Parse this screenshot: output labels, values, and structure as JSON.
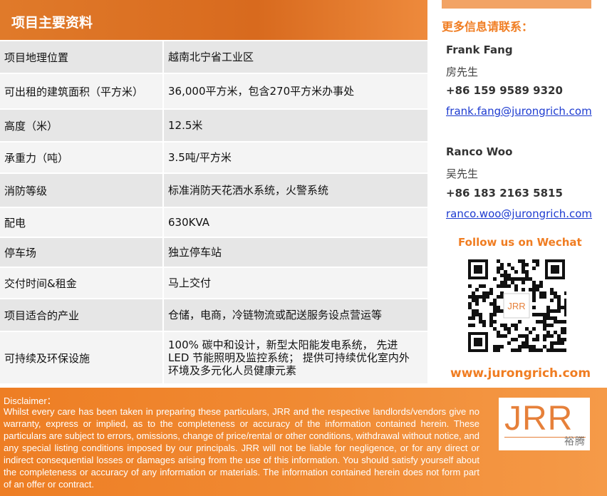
{
  "header": {
    "title": "项目主要资料"
  },
  "table": {
    "rows": [
      {
        "label": "项目地理位置",
        "value": "越南北宁省工业区"
      },
      {
        "label": "可出租的建筑面积（平方米）",
        "value": "36,000平方米，包含270平方米办事处"
      },
      {
        "label": "高度（米）",
        "value": "12.5米"
      },
      {
        "label": "承重力（吨）",
        "value": "3.5吨/平方米"
      },
      {
        "label": "消防等级",
        "value": "标准消防天花洒水系统，火警系统"
      },
      {
        "label": "配电",
        "value": "630KVA"
      },
      {
        "label": "停车场",
        "value": "独立停车站"
      },
      {
        "label": "交付时间&租金",
        "value": "马上交付"
      },
      {
        "label": "项目适合的产业",
        "value": "仓储，电商，冷链物流或配送服务设点营运等"
      },
      {
        "label": "可持续及环保设施",
        "value_lines": [
          "100% 碳中和设计，新型太阳能发电系统， 先进",
          "LED 节能照明及监控系统； 提供可持续优化室内外",
          "环境及多元化人员健康元素"
        ]
      }
    ]
  },
  "contact": {
    "title": "更多信息请联系：",
    "people": [
      {
        "name": "Frank Fang",
        "cn_name": "房先生",
        "phone": "+86 159 9589 9320",
        "email": "frank.fang@jurongrich.com"
      },
      {
        "name": "Ranco Woo",
        "cn_name": "吴先生",
        "phone": "+86 183 2163 5815",
        "email": "ranco.woo@jurongrich.com"
      }
    ],
    "follow": "Follow us on Wechat",
    "qr_center": "JRR",
    "website": "www.jurongrich.com"
  },
  "footer": {
    "disclaimer_label": "Disclaimer：",
    "disclaimer_text": "Whilst every care has been taken in preparing these particulars, JRR and the respective landlords/vendors give no warranty, express or implied, as to the completeness or accuracy of the information contained herein. These particulars are subject to errors, omissions, change of price/rental or other conditions, withdrawal without notice, and any special listing conditions imposed by our principals. JRR will not be liable for negligence, or for any direct or indirect consequential losses or damages arising from the use of this information. You should satisfy yourself about the completeness or accuracy of any information or materials. The information contained herein does not form part of an offer or contract.",
    "logo_text": "JRR",
    "logo_cn": "裕腾"
  },
  "colors": {
    "accent": "#f07d22",
    "header": "#e07a2a",
    "link": "#1d3bd0"
  }
}
